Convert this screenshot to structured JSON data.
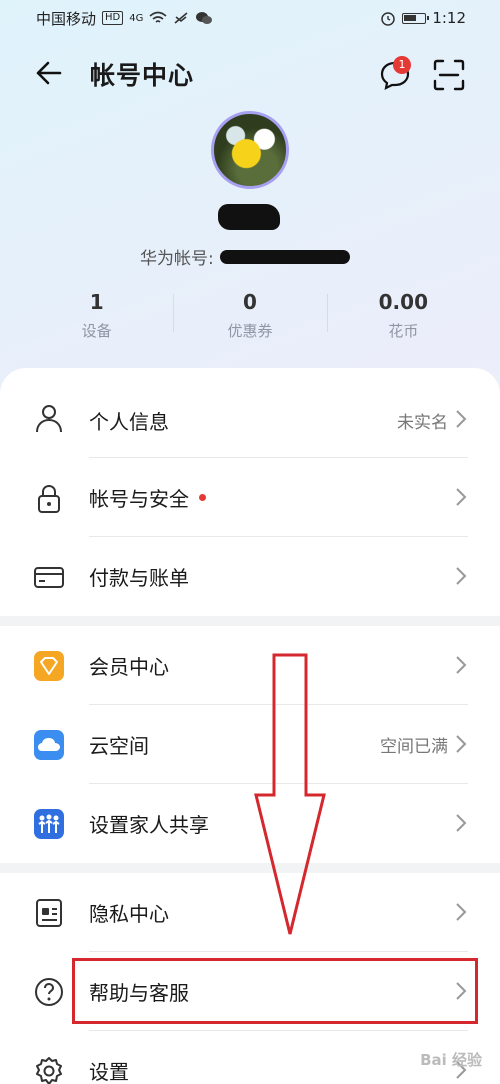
{
  "status_bar": {
    "carrier": "中国移动",
    "hd": "HD",
    "net": "4G",
    "time": "1:12"
  },
  "header": {
    "title": "帐号中心",
    "message_badge": "1"
  },
  "profile": {
    "account_label": "华为帐号:"
  },
  "stats": [
    {
      "value": "1",
      "label": "设备"
    },
    {
      "value": "0",
      "label": "优惠券"
    },
    {
      "value": "0.00",
      "label": "花币"
    }
  ],
  "menu": {
    "personal_info": {
      "label": "个人信息",
      "value": "未实名"
    },
    "account_security": {
      "label": "帐号与安全"
    },
    "payment": {
      "label": "付款与账单"
    },
    "vip": {
      "label": "会员中心"
    },
    "cloud": {
      "label": "云空间",
      "value": "空间已满"
    },
    "family": {
      "label": "设置家人共享"
    },
    "privacy": {
      "label": "隐私中心"
    },
    "help": {
      "label": "帮助与客服"
    },
    "settings": {
      "label": "设置"
    }
  },
  "watermark": "Bai 经验",
  "colors": {
    "accent_red": "#e53935",
    "annotation_red": "#d4282e",
    "vip_orange": "#f5a623",
    "cloud_blue": "#3b8ef0",
    "family_blue": "#2f6fe0"
  }
}
